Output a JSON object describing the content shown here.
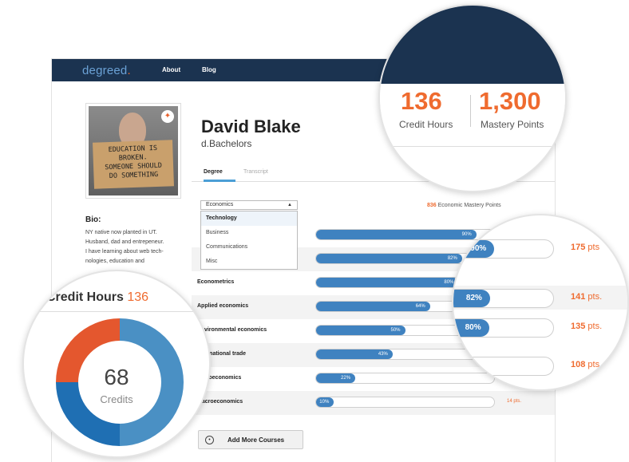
{
  "nav": {
    "logo": "degreed",
    "logo_dot": ".",
    "items": [
      "About",
      "Blog"
    ]
  },
  "profile": {
    "name": "David Blake",
    "degree": "d.Bachelors",
    "photo_sign": [
      "EDUCATION IS",
      "BROKEN.",
      "SOMEONE SHOULD",
      "DO SOMETHING"
    ],
    "bio_title": "Bio:",
    "bio_lines": [
      "NY native now planted in UT.",
      "Husband, dad and entrepeneur.",
      "I have learning about web tech-",
      "nologies, education and"
    ]
  },
  "tabs": [
    "Degree",
    "Transcript"
  ],
  "subject_select": {
    "value": "Economics",
    "options": [
      "Technology",
      "Business",
      "Communications",
      "Misc"
    ]
  },
  "mastery": {
    "value": "836",
    "label": "Economic Mastery Points"
  },
  "courses": [
    {
      "label": "",
      "percent": 90,
      "pct_label": "90%",
      "pts": ""
    },
    {
      "label": "",
      "percent": 82,
      "pct_label": "82%",
      "pts": ""
    },
    {
      "label": "Econometrics",
      "percent": 80,
      "pct_label": "80%",
      "pts": ""
    },
    {
      "label": "Applied economics",
      "percent": 64,
      "pct_label": "64%",
      "pts": ""
    },
    {
      "label": "Environmental economics",
      "percent": 50,
      "pct_label": "50%",
      "pts": ""
    },
    {
      "label": "International trade",
      "percent": 43,
      "pct_label": "43%",
      "pts": ""
    },
    {
      "label": "Microeconomics",
      "percent": 22,
      "pct_label": "22%",
      "pts": ""
    },
    {
      "label": "Macroeconomics",
      "percent": 10,
      "pct_label": "10%",
      "pts": "14 pts."
    }
  ],
  "add_button": "Add More Courses",
  "stats": {
    "credit_hours": "136",
    "credit_hours_label": "Credit Hours",
    "mastery_points": "1,300",
    "mastery_points_label": "Mastery Points"
  },
  "zoom_rows": [
    {
      "percent": 90,
      "pct_label": "90%",
      "pts": "175",
      "unit": "pts"
    },
    {
      "percent": 82,
      "pct_label": "82%",
      "pts": "141",
      "unit": "pts."
    },
    {
      "percent": 80,
      "pct_label": "80%",
      "pts": "135",
      "unit": "pts."
    },
    {
      "percent": 0,
      "pct_label": "",
      "pts": "108",
      "unit": "pts."
    }
  ],
  "credit_panel": {
    "title": "Credit Hours",
    "value": "136",
    "donut_value": "68",
    "donut_label": "Credits"
  },
  "donut_segments": [
    {
      "value": 50,
      "color": "#4a90c4"
    },
    {
      "value": 25,
      "color": "#1f6fb3"
    },
    {
      "value": 25,
      "color": "#e4572e"
    }
  ],
  "colors": {
    "accent": "#ef6b2f",
    "bar": "#3f82c0",
    "nav": "#1b3350"
  }
}
